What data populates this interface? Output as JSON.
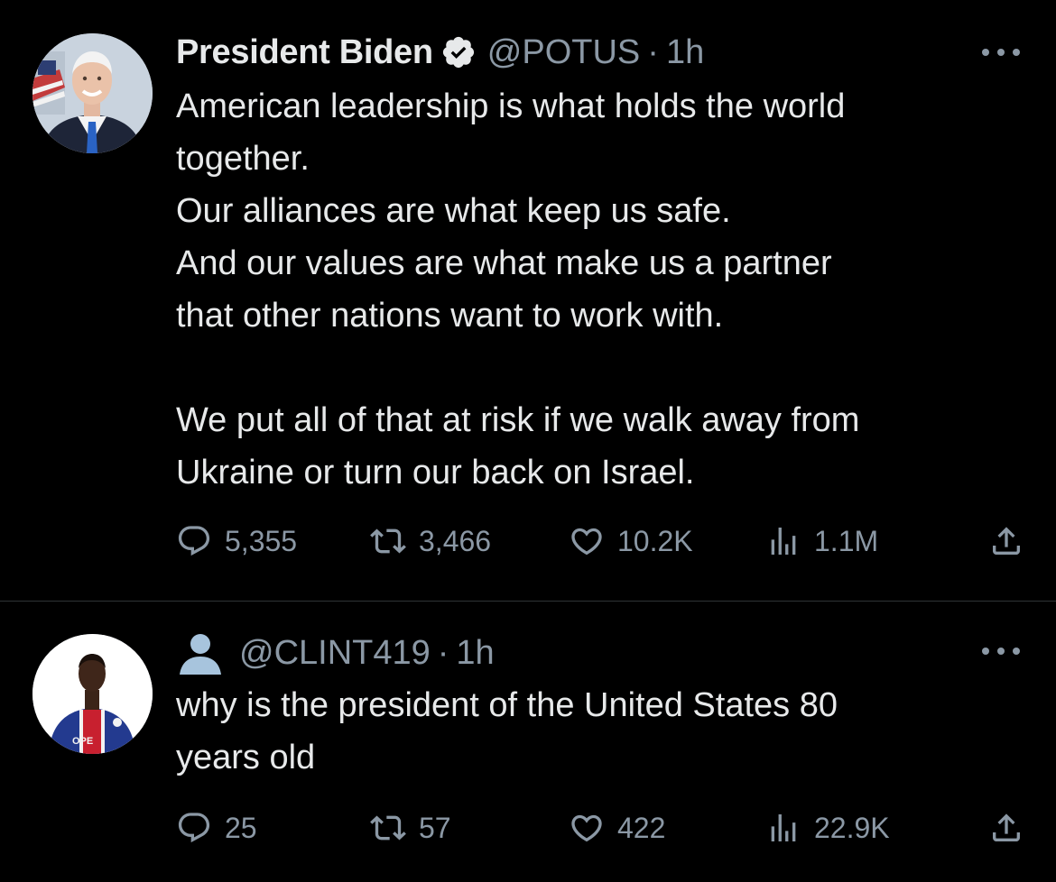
{
  "tweets": [
    {
      "display_name": "President Biden",
      "verified": true,
      "handle": "@POTUS",
      "separator": "·",
      "time": "1h",
      "text": "American leadership is what holds the world\ntogether.\nOur alliances are what keep us safe.\nAnd our values are what make us a partner\nthat other nations want to work with.\n\nWe put all of that at risk if we walk away from\nUkraine or turn our back on Israel.",
      "replies": "5,355",
      "retweets": "3,466",
      "likes": "10.2K",
      "views": "1.1M"
    },
    {
      "display_name": "",
      "verified": false,
      "handle": "@CLINT419",
      "separator": "·",
      "time": "1h",
      "text": "why is the president of the United States 80\nyears old",
      "replies": "25",
      "retweets": "57",
      "likes": "422",
      "views": "22.9K"
    }
  ],
  "icons": {
    "reply": "reply-icon",
    "retweet": "retweet-icon",
    "like": "heart-icon",
    "views": "views-icon",
    "share": "share-icon",
    "more": "more-icon",
    "verified": "verified-badge-icon",
    "default_user": "default-user-icon"
  },
  "colors": {
    "background": "#000000",
    "text_primary": "#e7e9ea",
    "text_secondary": "#8b98a5",
    "verified_badge": "#e7e9ea",
    "default_user_icon": "#a7c4dd"
  }
}
